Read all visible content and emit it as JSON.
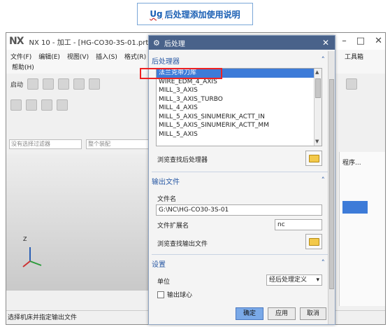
{
  "header": {
    "prefix": "Ug",
    "title": "后处理添加使用说明"
  },
  "nx": {
    "logo": "NX",
    "title": "NX 10 - 加工 - [HG-CO30-3S-01.prt]",
    "menu": [
      "文件(F)",
      "编辑(E)",
      "视图(V)",
      "插入(S)",
      "格式(R)"
    ],
    "menu2": "帮助(H)",
    "start_label": "启动",
    "filter_placeholder": "没有选择过滤器",
    "assembly_placeholder": "整个装配",
    "status_text": "选择机床并指定输出文件",
    "right_tab": "程序...",
    "right_menu": "工具箱",
    "axis_label": "Z"
  },
  "dialog": {
    "title": "后处理",
    "postprocessor": {
      "section": "后处理器",
      "items": [
        "法兰克带刀库",
        "WIRE_EDM_4_AXIS",
        "MILL_3_AXIS",
        "MILL_3_AXIS_TURBO",
        "MILL_4_AXIS",
        "MILL_5_AXIS_SINUMERIK_ACTT_IN",
        "MILL_5_AXIS_SINUMERIK_ACTT_MM",
        "MILL_5_AXIS"
      ],
      "selected_index": 0,
      "browse_label": "浏览查找后处理器"
    },
    "output": {
      "section": "输出文件",
      "filename_label": "文件名",
      "filename_value": "G:\\NC\\HG-CO30-3S-01",
      "ext_label": "文件扩展名",
      "ext_value": "nc",
      "browse_label": "浏览查找输出文件"
    },
    "settings": {
      "section": "设置",
      "unit_label": "单位",
      "unit_value": "经后处理定义",
      "ball_label": "输出球心"
    },
    "buttons": {
      "ok": "确定",
      "apply": "应用",
      "cancel": "取消"
    }
  },
  "colors": {
    "highlight": "#3d7bd8",
    "annotation": "#ee2222",
    "dialog_title": "#49628a"
  }
}
